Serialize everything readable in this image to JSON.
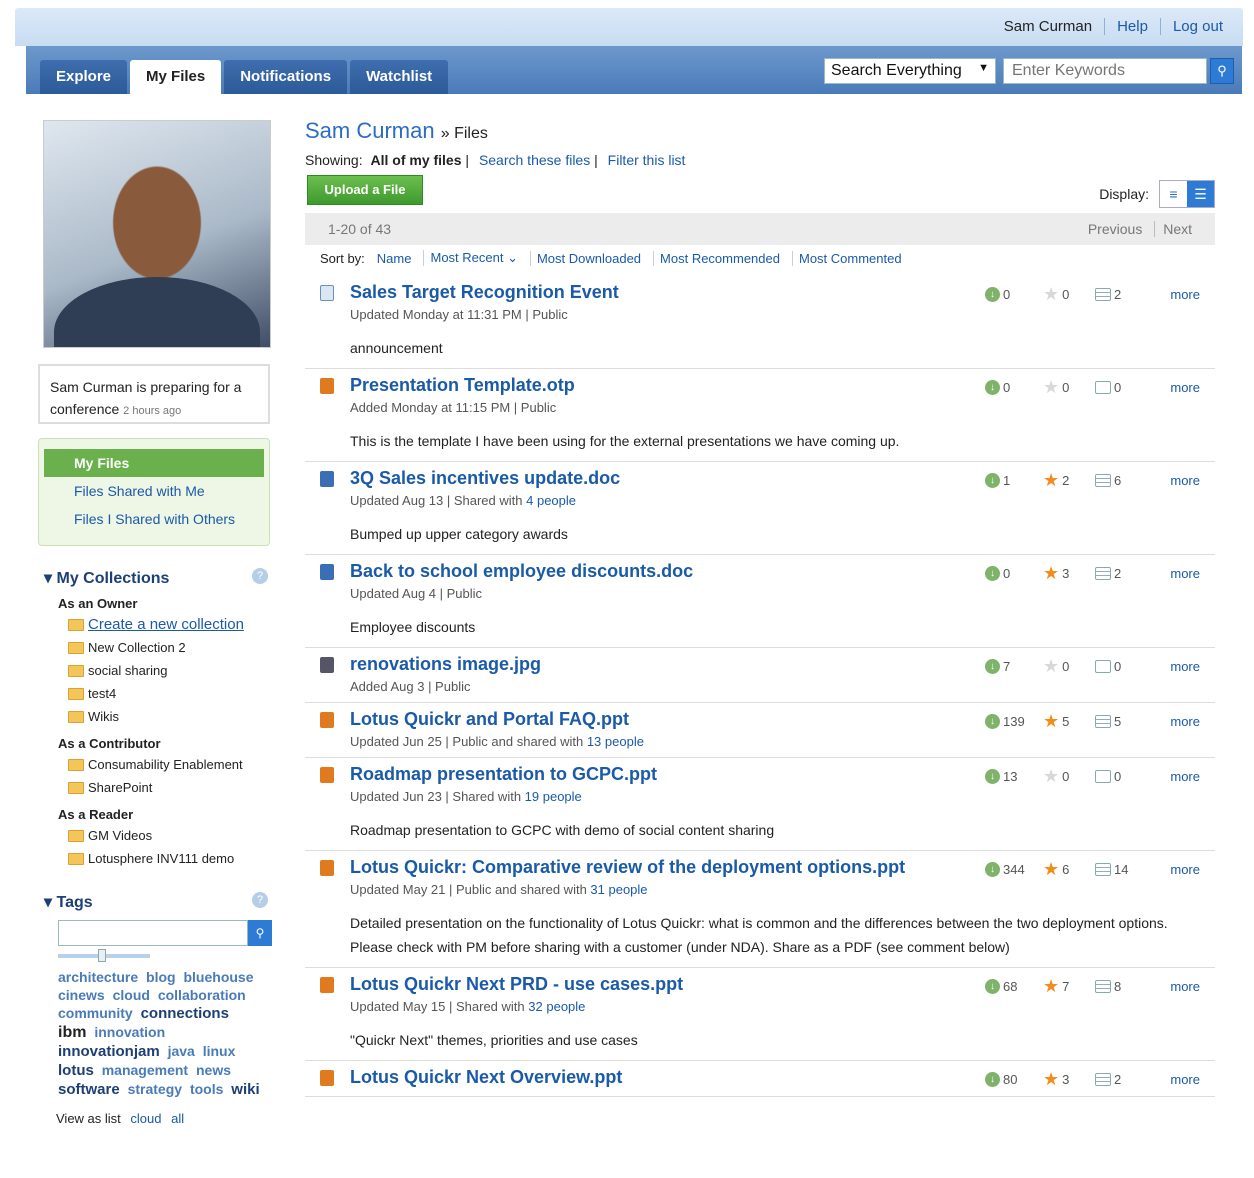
{
  "header": {
    "user": "Sam Curman",
    "help": "Help",
    "logout": "Log out"
  },
  "nav": {
    "tabs": [
      "Explore",
      "My Files",
      "Notifications",
      "Watchlist"
    ],
    "search_scope": "Search Everything",
    "search_placeholder": "Enter Keywords"
  },
  "profile": {
    "status_text": "Sam Curman is preparing for a conference",
    "status_time": "2 hours ago"
  },
  "files_nav": [
    "My Files",
    "Files Shared with Me",
    "Files I Shared with Others"
  ],
  "collections": {
    "title": "My Collections",
    "owner_label": "As an Owner",
    "create_label": "Create a new collection",
    "owner_items": [
      "New Collection 2",
      "social sharing",
      "test4",
      "Wikis"
    ],
    "contributor_label": "As a Contributor",
    "contributor_items": [
      "Consumability Enablement",
      "SharePoint"
    ],
    "reader_label": "As a Reader",
    "reader_items": [
      "GM Videos",
      "Lotusphere INV111 demo"
    ]
  },
  "tags": {
    "title": "Tags",
    "items": [
      "architecture",
      "blog",
      "bluehouse",
      "cinews",
      "cloud",
      "collaboration",
      "community",
      "connections",
      "ibm",
      "innovation",
      "innovationjam",
      "java",
      "linux",
      "lotus",
      "management",
      "news",
      "software",
      "strategy",
      "tools",
      "wiki"
    ],
    "view_as": "View as list",
    "cloud": "cloud",
    "all": "all"
  },
  "main": {
    "owner": "Sam Curman",
    "crumb": "» Files",
    "showing_label": "Showing:",
    "showing_value": "All of my files",
    "search_files": "Search these files",
    "filter": "Filter this list",
    "upload": "Upload a File",
    "display_label": "Display:",
    "range": "1-20 of 43",
    "previous": "Previous",
    "next": "Next",
    "sort_label": "Sort by:",
    "sort": [
      "Name",
      "Most Recent ⌄",
      "Most Downloaded",
      "Most Recommended",
      "Most Commented"
    ],
    "more": "more"
  },
  "files": [
    {
      "icon": "page",
      "title": "Sales Target Recognition Event",
      "meta": "Updated Monday at 11:31 PM | Public",
      "people": "",
      "desc": "announcement",
      "dl": "0",
      "stars": "0",
      "star_on": false,
      "comments": "2",
      "has_comments": true
    },
    {
      "icon": "ppt",
      "title": "Presentation Template.otp",
      "meta": "Added Monday at 11:15 PM | Public",
      "people": "",
      "desc": "This is the template I have been using for the external presentations we have coming up.",
      "dl": "0",
      "stars": "0",
      "star_on": false,
      "comments": "0",
      "has_comments": false
    },
    {
      "icon": "doc",
      "title": "3Q Sales incentives update.doc",
      "meta": "Updated Aug 13 | Shared with",
      "people": "4 people",
      "desc": "Bumped up upper category awards",
      "dl": "1",
      "stars": "2",
      "star_on": true,
      "comments": "6",
      "has_comments": true
    },
    {
      "icon": "doc",
      "title": "Back to school employee discounts.doc",
      "meta": "Updated Aug 4 | Public",
      "people": "",
      "desc": "Employee discounts",
      "dl": "0",
      "stars": "3",
      "star_on": true,
      "comments": "2",
      "has_comments": true
    },
    {
      "icon": "img",
      "title": "renovations image.jpg",
      "meta": "Added Aug 3 | Public",
      "people": "",
      "desc": "",
      "dl": "7",
      "stars": "0",
      "star_on": false,
      "comments": "0",
      "has_comments": false
    },
    {
      "icon": "ppt",
      "title": "Lotus Quickr and Portal FAQ.ppt",
      "meta": "Updated Jun 25 | Public and shared with",
      "people": "13 people",
      "desc": "",
      "dl": "139",
      "stars": "5",
      "star_on": true,
      "comments": "5",
      "has_comments": true
    },
    {
      "icon": "ppt",
      "title": "Roadmap presentation to GCPC.ppt",
      "meta": "Updated Jun 23 | Shared with",
      "people": "19 people",
      "desc": "Roadmap presentation to GCPC with demo of social content sharing",
      "dl": "13",
      "stars": "0",
      "star_on": false,
      "comments": "0",
      "has_comments": false
    },
    {
      "icon": "ppt",
      "title": "Lotus Quickr: Comparative review of the deployment options.ppt",
      "meta": "Updated May 21 | Public and shared with",
      "people": "31 people",
      "desc": "Detailed presentation on the functionality of Lotus Quickr: what is common and the differences between the two deployment options. Please check with PM before sharing with a customer (under NDA). Share as a PDF (see comment below)",
      "dl": "344",
      "stars": "6",
      "star_on": true,
      "comments": "14",
      "has_comments": true
    },
    {
      "icon": "ppt",
      "title": "Lotus Quickr Next PRD - use cases.ppt",
      "meta": "Updated May 15 | Shared with",
      "people": "32 people",
      "desc": "\"Quickr Next\" themes, priorities and use cases",
      "dl": "68",
      "stars": "7",
      "star_on": true,
      "comments": "8",
      "has_comments": true
    },
    {
      "icon": "ppt",
      "title": "Lotus Quickr Next Overview.ppt",
      "meta": "",
      "people": "",
      "desc": "",
      "dl": "80",
      "stars": "3",
      "star_on": true,
      "comments": "2",
      "has_comments": true
    }
  ]
}
